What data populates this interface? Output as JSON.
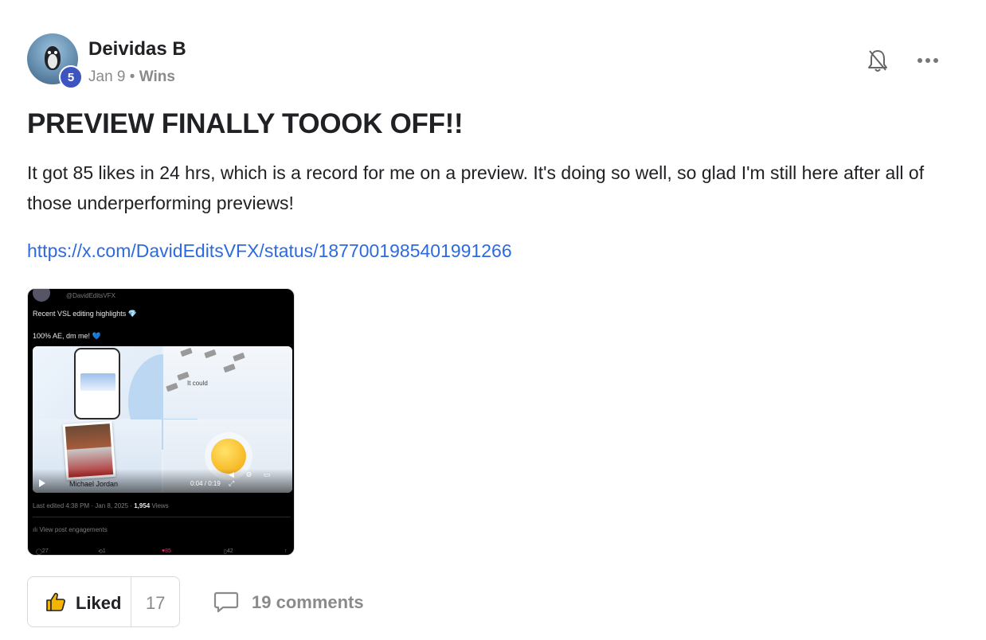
{
  "post": {
    "author": "Deividas B",
    "level": "5",
    "date": "Jan 9",
    "separator": "•",
    "category": "Wins",
    "title": "PREVIEW FINALLY TOOOK OFF!!",
    "body": "It got 85 likes in 24 hrs, which is a record for me on a preview. It's doing so well, so glad I'm still here after all of those underperforming previews!",
    "link": "https://x.com/DavidEditsVFX/status/1877001985401991266"
  },
  "attachment": {
    "handle": "@DavidEditsVFX",
    "line1": "Recent VSL editing highlights",
    "line2": "100% AE, dm me!",
    "gem_icon": "💎",
    "heart_icon": "💙",
    "video_caption": "It could",
    "video_label": "Michael Jordan",
    "video_time": "0:04 / 0:19",
    "edited_prefix": "Last edited 4:38 PM · Jan 8, 2025 ·",
    "views_count": "1,954",
    "views_label": "Views",
    "engagements": "View post engagements",
    "replies": "27",
    "reposts": "1",
    "likes": "85",
    "bookmarks": "42"
  },
  "actions": {
    "like_label": "Liked",
    "like_count": "17",
    "comments_label": "19 comments"
  },
  "icons": {
    "bell": "bell-off-icon",
    "more": "more-horizontal-icon",
    "thumb": "thumbs-up-icon",
    "comment": "comment-icon"
  },
  "colors": {
    "link": "#2d6ae0",
    "badge": "#3d55c0",
    "muted": "#8a8a8a",
    "thumb": "#f5b400"
  }
}
